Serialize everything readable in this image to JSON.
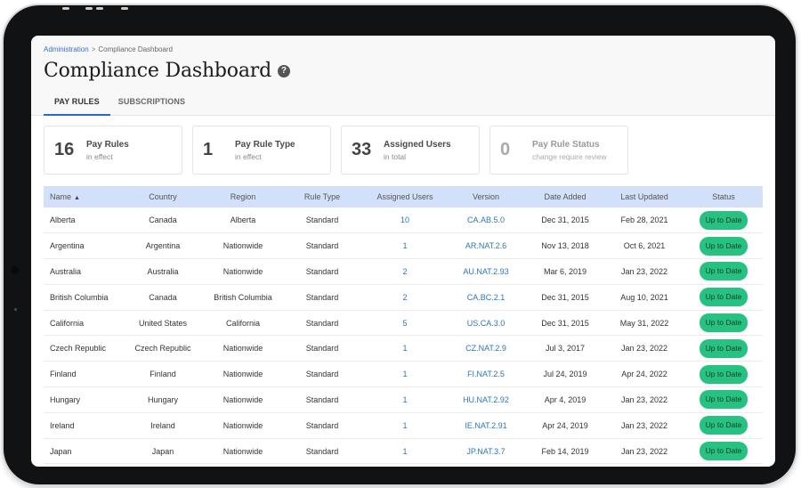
{
  "breadcrumb": {
    "parent": "Administration",
    "separator": ">",
    "current": "Compliance Dashboard"
  },
  "page_title": "Compliance Dashboard",
  "help_icon": "?",
  "tabs": [
    {
      "label": "PAY RULES",
      "active": true
    },
    {
      "label": "SUBSCRIPTIONS",
      "active": false
    }
  ],
  "summary_cards": [
    {
      "value": "16",
      "label": "Pay Rules",
      "sub": "in effect"
    },
    {
      "value": "1",
      "label": "Pay Rule Type",
      "sub": "in effect"
    },
    {
      "value": "33",
      "label": "Assigned Users",
      "sub": "in total"
    },
    {
      "value": "0",
      "label": "Pay Rule Status",
      "sub": "change require review"
    }
  ],
  "table": {
    "sort_indicator": "▲",
    "columns": [
      "Name",
      "Country",
      "Region",
      "Rule Type",
      "Assigned Users",
      "Version",
      "Date Added",
      "Last Updated",
      "Status"
    ],
    "rows": [
      {
        "name": "Alberta",
        "country": "Canada",
        "region": "Alberta",
        "rule_type": "Standard",
        "assigned_users": "10",
        "version": "CA.AB.5.0",
        "date_added": "Dec 31, 2015",
        "last_updated": "Feb 28, 2021",
        "status": "Up to Date"
      },
      {
        "name": "Argentina",
        "country": "Argentina",
        "region": "Nationwide",
        "rule_type": "Standard",
        "assigned_users": "1",
        "version": "AR.NAT.2.6",
        "date_added": "Nov 13, 2018",
        "last_updated": "Oct 6, 2021",
        "status": "Up to Date"
      },
      {
        "name": "Australia",
        "country": "Australia",
        "region": "Nationwide",
        "rule_type": "Standard",
        "assigned_users": "2",
        "version": "AU.NAT.2.93",
        "date_added": "Mar 6, 2019",
        "last_updated": "Jan 23, 2022",
        "status": "Up to Date"
      },
      {
        "name": "British Columbia",
        "country": "Canada",
        "region": "British Columbia",
        "rule_type": "Standard",
        "assigned_users": "2",
        "version": "CA.BC.2.1",
        "date_added": "Dec 31, 2015",
        "last_updated": "Aug 10, 2021",
        "status": "Up to Date"
      },
      {
        "name": "California",
        "country": "United States",
        "region": "California",
        "rule_type": "Standard",
        "assigned_users": "5",
        "version": "US.CA.3.0",
        "date_added": "Dec 31, 2015",
        "last_updated": "May 31, 2022",
        "status": "Up to Date"
      },
      {
        "name": "Czech Republic",
        "country": "Czech Republic",
        "region": "Nationwide",
        "rule_type": "Standard",
        "assigned_users": "1",
        "version": "CZ.NAT.2.9",
        "date_added": "Jul 3, 2017",
        "last_updated": "Jan 23, 2022",
        "status": "Up to Date"
      },
      {
        "name": "Finland",
        "country": "Finland",
        "region": "Nationwide",
        "rule_type": "Standard",
        "assigned_users": "1",
        "version": "FI.NAT.2.5",
        "date_added": "Jul 24, 2019",
        "last_updated": "Apr 24, 2022",
        "status": "Up to Date"
      },
      {
        "name": "Hungary",
        "country": "Hungary",
        "region": "Nationwide",
        "rule_type": "Standard",
        "assigned_users": "1",
        "version": "HU.NAT.2.92",
        "date_added": "Apr 4, 2019",
        "last_updated": "Jan 23, 2022",
        "status": "Up to Date"
      },
      {
        "name": "Ireland",
        "country": "Ireland",
        "region": "Nationwide",
        "rule_type": "Standard",
        "assigned_users": "1",
        "version": "IE.NAT.2.91",
        "date_added": "Apr 24, 2019",
        "last_updated": "Jan 23, 2022",
        "status": "Up to Date"
      },
      {
        "name": "Japan",
        "country": "Japan",
        "region": "Nationwide",
        "rule_type": "Standard",
        "assigned_users": "1",
        "version": "JP.NAT.3.7",
        "date_added": "Feb 14, 2019",
        "last_updated": "Jan 23, 2022",
        "status": "Up to Date"
      }
    ]
  },
  "colors": {
    "accent": "#2a66d1",
    "header_row": "#d3e0fa",
    "link": "#2b77b5",
    "status_ok": "#27c281"
  }
}
